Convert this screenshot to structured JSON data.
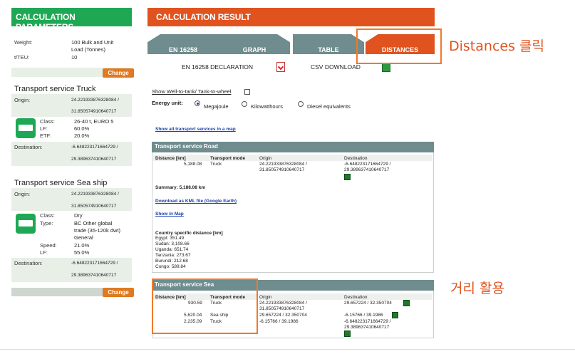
{
  "left": {
    "header": "CALCULATION PARAMETERS",
    "params": {
      "weight_label": "Weight:",
      "weight_value_1": "100 Bulk and Unit",
      "weight_value_2": "Load (Tonnes)",
      "teu_label": "t/TEU:",
      "teu_value": "10"
    },
    "change_label": "Change",
    "truck": {
      "title": "Transport service Truck",
      "origin_label": "Origin:",
      "origin_1": "24.221933876328084 /",
      "origin_2": "31.850574910640717",
      "class_label": "Class:",
      "class_value": "26-40 t, EURO 5",
      "lf_label": "LF:",
      "lf_value": "60.0%",
      "etf_label": "ETF:",
      "etf_value": "20.0%",
      "destination_label": "Destination:",
      "dest_1": "-6.648223171664729 /",
      "dest_2": "29.389637410640717"
    },
    "ship": {
      "title": "Transport service Sea ship",
      "origin_label": "Origin:",
      "origin_1": "24.221933876328084 /",
      "origin_2": "31.850574910640717",
      "class_label": "Class:",
      "class_value": "Dry",
      "type_label": "Type:",
      "type_1": "BC Other global",
      "type_2": "trade (35-120k dwt)",
      "type_3": "General",
      "speed_label": "Speed:",
      "speed_value": "21.0%",
      "lf_label": "LF:",
      "lf_value": "55.0%",
      "destination_label": "Destination:",
      "dest_1": "-6.648223171664729 /",
      "dest_2": "29.389637410640717"
    }
  },
  "right": {
    "header": "CALCULATION RESULT",
    "tabs": [
      "EN 16258",
      "GRAPH",
      "TABLE",
      "DISTANCES"
    ],
    "declaration": "EN 16258 DECLARATION",
    "csv": "CSV DOWNLOAD",
    "well_to_tank": "Show Well-to-tank/ Tank-to-wheel",
    "energy_unit_label": "Energy unit:",
    "energy_options": [
      "Megajoule",
      "Kilowatthours",
      "Diesel equivalents"
    ],
    "show_all_link": "Show all transport services in a map",
    "road": {
      "title": "Transport service Road",
      "col_distance": "Distance [km]",
      "col_mode": "Transport mode",
      "col_origin": "Origin",
      "col_destination": "Destination",
      "row": {
        "distance": "5,188.08",
        "mode": "Truck",
        "origin_1": "24.221933876328084 /",
        "origin_2": "31.850574910640717",
        "dest_1": "-6.648223171664729 /",
        "dest_2": "29.389637410640717"
      },
      "summary": "Summary: 5,188.08 km",
      "kml_link": "Download as KML file (Google Earth)",
      "map_link": "Show in Map",
      "country_title": "Country specific distance [km]",
      "countries": [
        "Egypt: 351.49",
        "Sudan: 3,108.66",
        "Uganda: 651.74",
        "Tanzania: 273.67",
        "Burundi: 212.68",
        "Congo: 589.84"
      ]
    },
    "sea": {
      "title": "Transport service Sea",
      "col_distance": "Distance [km]",
      "col_mode": "Transport mode",
      "col_origin": "Origin",
      "col_destination": "Destination",
      "rows": [
        {
          "distance": "930.59",
          "mode": "Truck",
          "origin_1": "24.221933876328084 /",
          "origin_2": "31.850574910640717",
          "dest_1": "29.657224 / 32.350704",
          "dest_2": ""
        },
        {
          "distance": "5,620.04",
          "mode": "Sea ship",
          "origin_1": "29.657224 / 32.350704",
          "origin_2": "",
          "dest_1": "-6.15766 / 39.1986",
          "dest_2": ""
        },
        {
          "distance": "2,235.09",
          "mode": "Truck",
          "origin_1": "-6.15766 / 39.1986",
          "origin_2": "",
          "dest_1": "-6.648223171664729 /",
          "dest_2": "29.389637410640717"
        }
      ]
    }
  },
  "annotations": {
    "distances_click": "Distances 클릭",
    "distance_use": "거리 활용"
  }
}
